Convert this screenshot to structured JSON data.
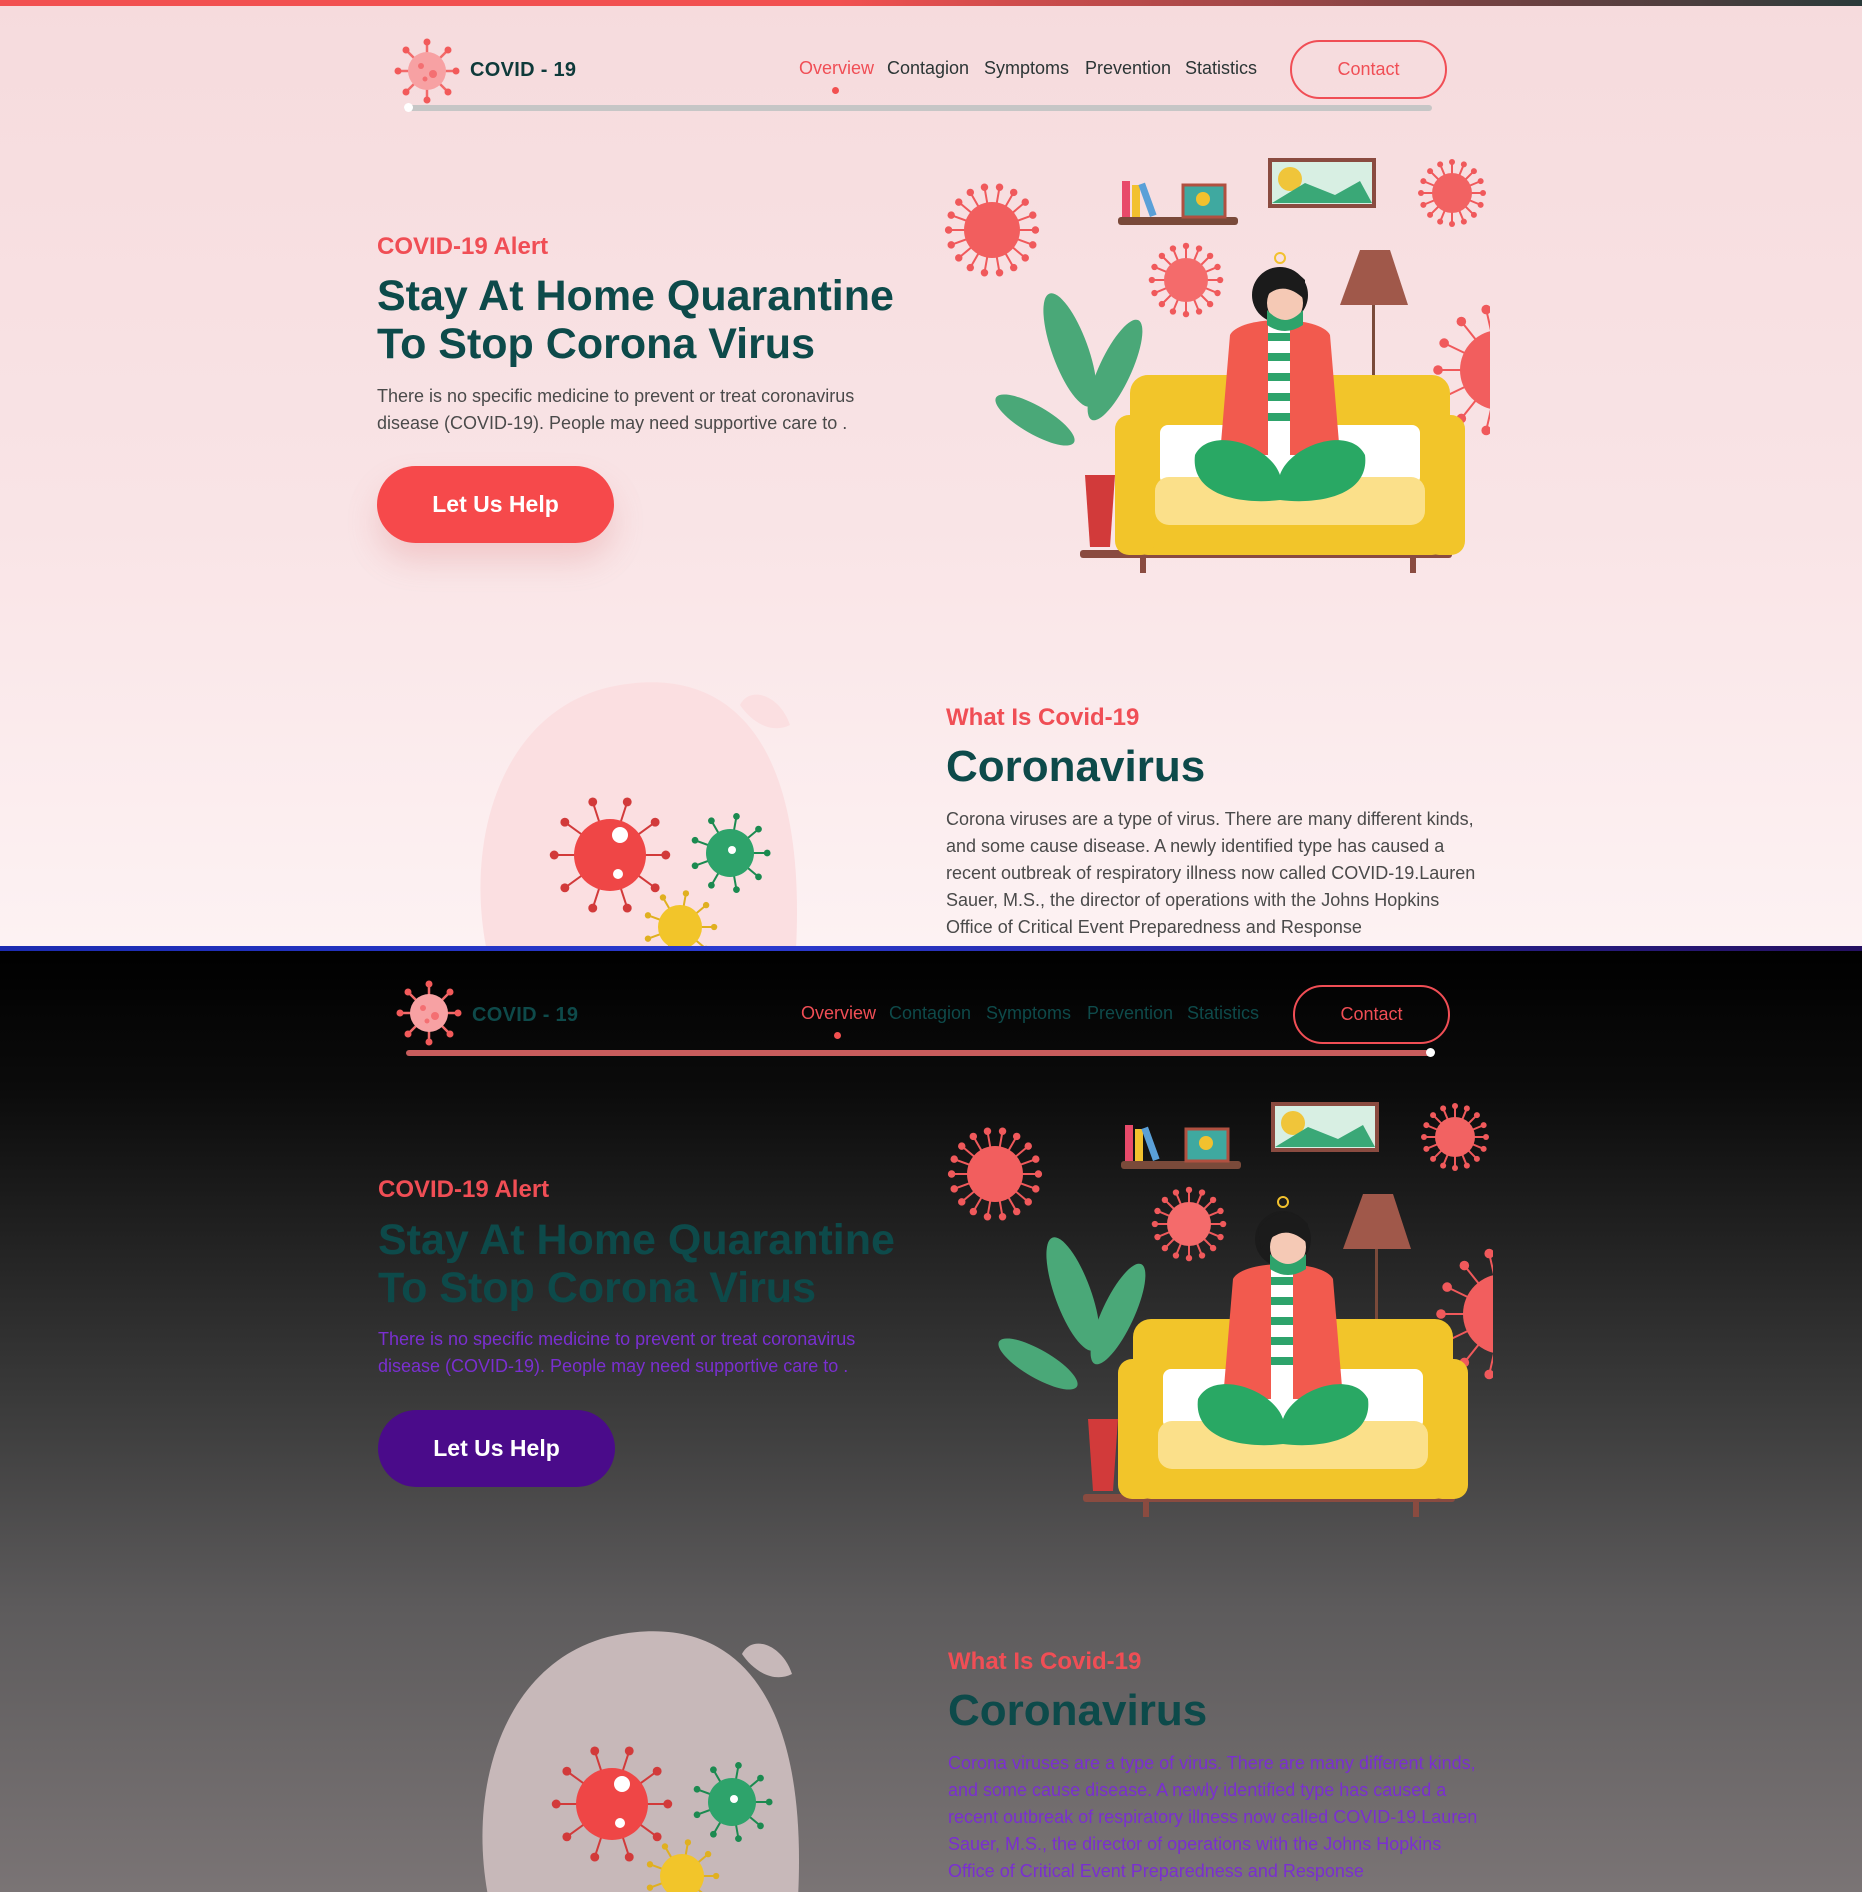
{
  "nav": {
    "brand": "COVID - 19",
    "links": [
      "Overview",
      "Contagion",
      "Symptoms",
      "Prevention",
      "Statistics"
    ],
    "active_link": "Overview",
    "contact_label": "Contact"
  },
  "hero": {
    "eyebrow": "COVID-19 Alert",
    "title_line1": "Stay At Home Quarantine",
    "title_line2": "To Stop Corona Virus",
    "text_line1": "There is no specific medicine to prevent or treat coronavirus",
    "text_line2": "disease (COVID-19). People may need supportive care to .",
    "cta_label": "Let Us Help"
  },
  "about": {
    "eyebrow": "What Is Covid-19",
    "title": "Coronavirus",
    "lines": [
      "Corona viruses are a type of virus. There are many different kinds,",
      "and some cause disease. A newly identified type has caused a",
      "recent outbreak of respiratory illness now called COVID-19.Lauren",
      "Sauer, M.S., the director of operations with the Johns Hopkins",
      "Office of Critical Event Preparedness and Response"
    ]
  },
  "themes": {
    "light": {
      "accent": "#f04e55",
      "heading": "#0d4a4a",
      "button": "#f6494b",
      "scroll_progress": 0.0
    },
    "dark": {
      "accent": "#f04e55",
      "heading": "#0d4a4a",
      "button": "#4a0b8a",
      "text": "#7a2fd0",
      "scroll_progress": 1.0
    }
  },
  "icons": [
    "virus-logo-icon",
    "woman-on-sofa-illustration",
    "virus-cluster-illustration"
  ]
}
